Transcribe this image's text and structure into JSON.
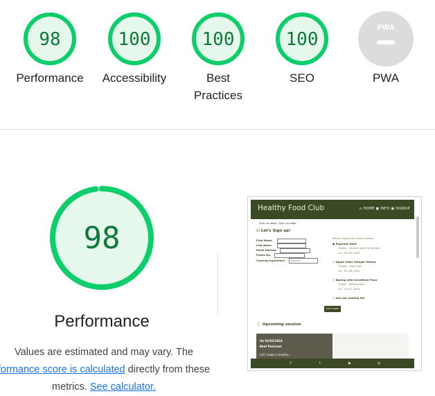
{
  "summary": {
    "gauges": [
      {
        "label": "Performance",
        "score": "98",
        "fraction": 0.98,
        "color": "#0cce6b"
      },
      {
        "label": "Accessibility",
        "score": "100",
        "fraction": 1.0,
        "color": "#0cce6b"
      },
      {
        "label": "Best Practices",
        "score": "100",
        "fraction": 1.0,
        "color": "#0cce6b"
      },
      {
        "label": "SEO",
        "score": "100",
        "fraction": 1.0,
        "color": "#0cce6b"
      },
      {
        "label": "PWA",
        "badge": "PWA",
        "color": "#cccccc"
      }
    ]
  },
  "performance": {
    "score": "98",
    "fraction": 0.98,
    "title": "Performance",
    "note_prefix": "Values are estimated and may vary. The",
    "note_link": "formance score is calculated",
    "note_mid": "directly from these metrics.",
    "calc_link": "See calculator."
  },
  "thumbnail": {
    "brand": "Healthy Food Club",
    "nav": "⌂ HOME  ● INFO  ▣ SIGNUP",
    "crumb": "Sign up page / Sign up page",
    "signup_heading": "☑ Let's Sign up!",
    "fields": [
      "First Name",
      "Last Name",
      "Email Address",
      "Phone No.",
      "Cooking experience"
    ],
    "select_value": "beginner",
    "sessions_intro": "Please choose the session below.",
    "sessions": [
      {
        "name": "Pastrami Beef",
        "line1": "Theme - Sodium nitrite & nitrates",
        "line2": "On : 03 /05 /2024"
      },
      {
        "name": "Apple Cider Vinegar Drinks",
        "line1": "Theme - Leaky gut",
        "line2": "On : 03 /06 /2024"
      },
      {
        "name": "Baking with Unrefined Flour",
        "line1": "Theme - Refined flour",
        "line2": "On : 03 /07 /2024"
      }
    ],
    "mailing": "Join our mailing list",
    "button": "Let's cook!",
    "upcoming": "Upcoming session",
    "card_date": "On 03/05/2024",
    "card_title": "Beef Pastrami",
    "card_body": "Let's make a healthy...",
    "footer_icons": [
      "f",
      "t",
      "▶",
      "◎"
    ]
  }
}
